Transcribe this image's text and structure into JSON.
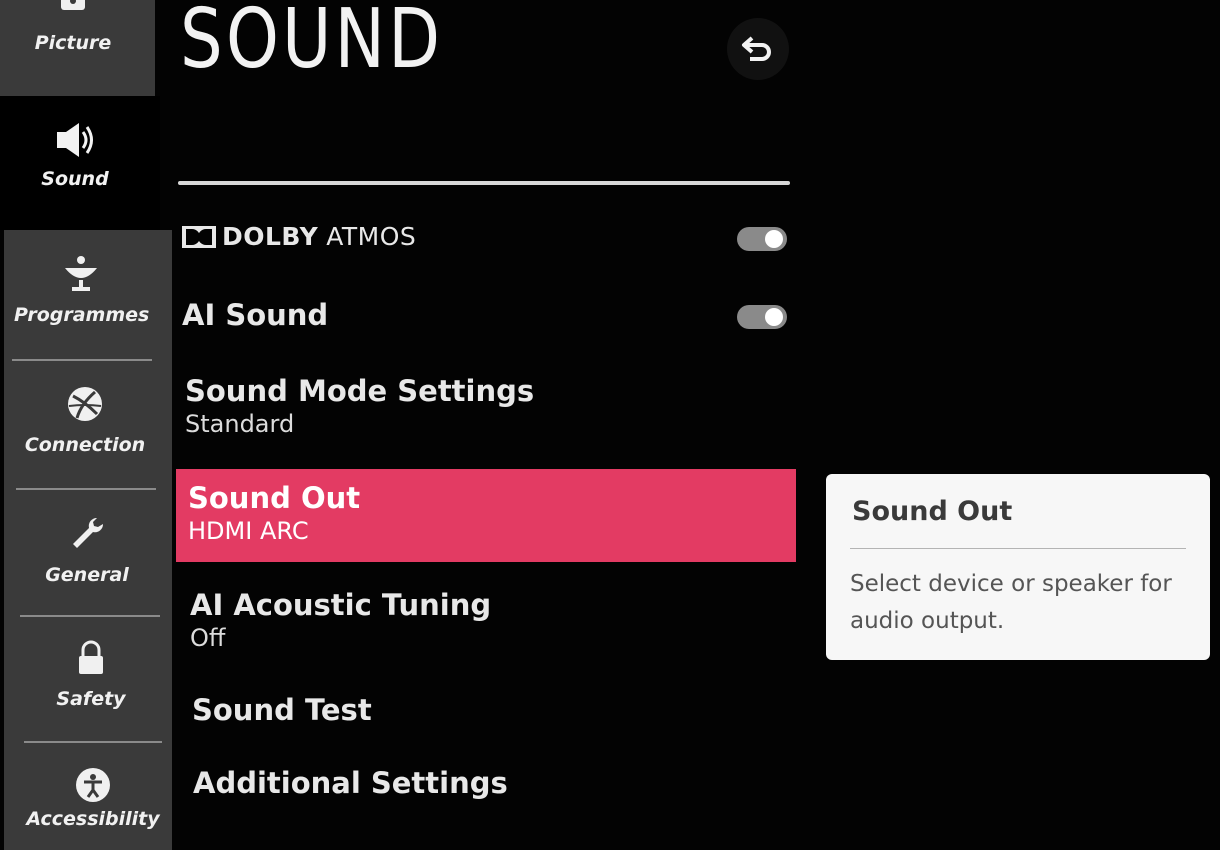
{
  "sidebar": {
    "items": [
      {
        "label": "Picture",
        "icon": "picture-icon"
      },
      {
        "label": "Sound",
        "icon": "speaker-icon",
        "active": true
      },
      {
        "label": "Programmes",
        "icon": "satellite-dish-icon"
      },
      {
        "label": "Connection",
        "icon": "globe-icon"
      },
      {
        "label": "General",
        "icon": "wrench-icon"
      },
      {
        "label": "Safety",
        "icon": "lock-icon"
      },
      {
        "label": "Accessibility",
        "icon": "accessibility-icon"
      }
    ]
  },
  "header": {
    "title": "SOUND",
    "back_icon": "back-arrow-icon"
  },
  "menu": {
    "dolby": {
      "brand": "DOLBY",
      "product": "ATMOS",
      "enabled": true
    },
    "ai_sound": {
      "label": "AI Sound",
      "enabled": true
    },
    "sound_mode": {
      "label": "Sound Mode Settings",
      "value": "Standard"
    },
    "sound_out": {
      "label": "Sound Out",
      "value": "HDMI ARC"
    },
    "ai_acoustic": {
      "label": "AI Acoustic Tuning",
      "value": "Off"
    },
    "sound_test": {
      "label": "Sound Test"
    },
    "additional": {
      "label": "Additional Settings"
    }
  },
  "info_panel": {
    "title": "Sound Out",
    "description": "Select device or speaker for audio output."
  },
  "colors": {
    "accent": "#e33b63",
    "sidebar": "#3a3a3a",
    "background": "#030303"
  }
}
